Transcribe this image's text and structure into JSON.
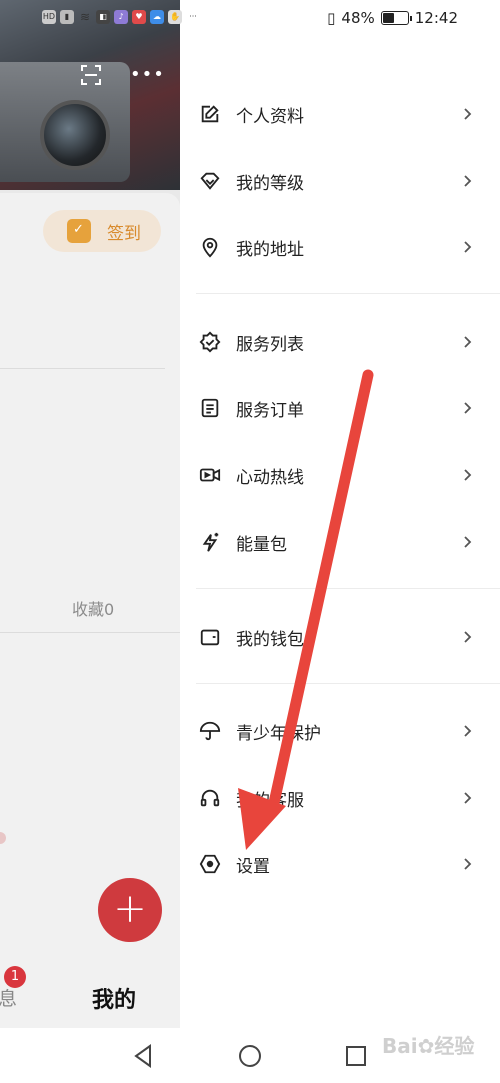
{
  "status_bar": {
    "battery_percent": "48%",
    "battery_level": 0.48,
    "time": "12:42",
    "left_icons": [
      "hd-icon",
      "signal-icon",
      "wifi-icon",
      "app-icon-1",
      "app-icon-2",
      "app-icon-3",
      "cloud-icon",
      "notification-icon"
    ]
  },
  "background_app": {
    "checkin_label": "签到",
    "favorites_label": "收藏0",
    "bottom_nav": {
      "messages_partial": "息",
      "messages_badge": "1",
      "mine_label": "我的"
    }
  },
  "drawer": {
    "groups": [
      {
        "items": [
          {
            "label": "个人资料",
            "icon": "edit-icon"
          },
          {
            "label": "我的等级",
            "icon": "diamond-icon"
          },
          {
            "label": "我的地址",
            "icon": "location-pin-icon"
          }
        ]
      },
      {
        "items": [
          {
            "label": "服务列表",
            "icon": "badge-check-icon"
          },
          {
            "label": "服务订单",
            "icon": "document-icon"
          },
          {
            "label": "心动热线",
            "icon": "video-call-icon"
          },
          {
            "label": "能量包",
            "icon": "sparkle-icon"
          }
        ]
      },
      {
        "items": [
          {
            "label": "我的钱包",
            "icon": "wallet-icon"
          }
        ]
      },
      {
        "items": [
          {
            "label": "青少年保护",
            "icon": "umbrella-icon"
          },
          {
            "label": "我的客服",
            "icon": "headset-icon"
          },
          {
            "label": "设置",
            "icon": "settings-hexagon-icon"
          }
        ]
      }
    ]
  },
  "annotation": {
    "arrow_color": "#e8453c"
  }
}
